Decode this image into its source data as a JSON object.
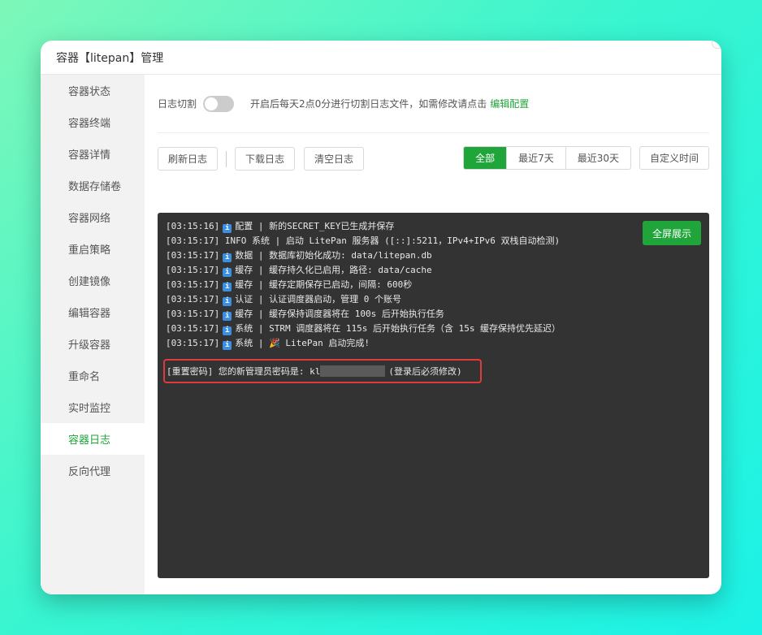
{
  "window": {
    "title": "容器【litepan】管理"
  },
  "sidebar": {
    "items": [
      {
        "label": "容器状态",
        "active": false
      },
      {
        "label": "容器终端",
        "active": false
      },
      {
        "label": "容器详情",
        "active": false
      },
      {
        "label": "数据存储卷",
        "active": false
      },
      {
        "label": "容器网络",
        "active": false
      },
      {
        "label": "重启策略",
        "active": false
      },
      {
        "label": "创建镜像",
        "active": false
      },
      {
        "label": "编辑容器",
        "active": false
      },
      {
        "label": "升级容器",
        "active": false
      },
      {
        "label": "重命名",
        "active": false
      },
      {
        "label": "实时监控",
        "active": false
      },
      {
        "label": "容器日志",
        "active": true
      },
      {
        "label": "反向代理",
        "active": false
      }
    ]
  },
  "log_split": {
    "label": "日志切割",
    "enabled": false,
    "description": "开启后每天2点0分进行切割日志文件，如需修改请点击",
    "edit_link": "编辑配置"
  },
  "toolbar": {
    "refresh": "刷新日志",
    "download": "下载日志",
    "clear": "清空日志",
    "ranges": [
      {
        "label": "全部",
        "active": true
      },
      {
        "label": "最近7天",
        "active": false
      },
      {
        "label": "最近30天",
        "active": false
      }
    ],
    "custom": "自定义时间"
  },
  "console": {
    "fullscreen": "全屏展示",
    "lines": [
      {
        "time": "[03:15:16]",
        "icon": true,
        "text": "配置 | 新的SECRET_KEY已生成并保存"
      },
      {
        "time": "[03:15:17]",
        "icon": false,
        "text": "INFO 系统 | 启动 LitePan 服务器 ([::]:5211，IPv4+IPv6 双栈自动检测)"
      },
      {
        "time": "[03:15:17]",
        "icon": true,
        "text": "数据 | 数据库初始化成功: data/litepan.db"
      },
      {
        "time": "[03:15:17]",
        "icon": true,
        "text": "缓存 | 缓存持久化已启用，路径: data/cache"
      },
      {
        "time": "[03:15:17]",
        "icon": true,
        "text": "缓存 | 缓存定期保存已启动，间隔: 600秒"
      },
      {
        "time": "[03:15:17]",
        "icon": true,
        "text": "认证 | 认证调度器启动，管理 0 个账号"
      },
      {
        "time": "[03:15:17]",
        "icon": true,
        "text": "缓存 | 缓存保持调度器将在 100s 后开始执行任务"
      },
      {
        "time": "[03:15:17]",
        "icon": true,
        "text": "系统 | STRM 调度器将在 115s 后开始执行任务（含 15s 缓存保持优先延迟）"
      },
      {
        "time": "[03:15:17]",
        "icon": true,
        "text": "系统 | 🎉 LitePan 启动完成!"
      }
    ],
    "password_prefix": "[重置密码] 您的新管理员密码是: kl",
    "password_suffix": "(登录后必须修改)"
  },
  "colors": {
    "accent": "#20a53a",
    "console_bg": "#333333",
    "highlight_border": "#e0393e"
  }
}
